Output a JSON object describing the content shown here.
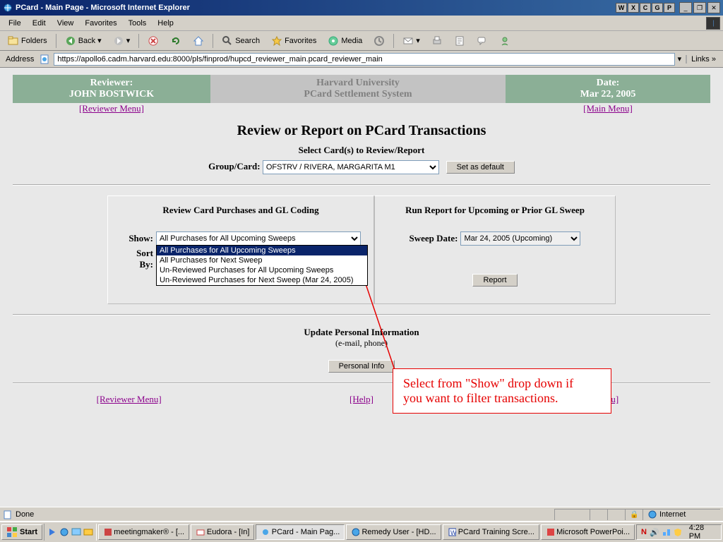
{
  "window": {
    "title": "PCard - Main Page - Microsoft Internet Explorer",
    "minimize": "_",
    "restore": "❐",
    "close": "✕"
  },
  "tray_icons": [
    "W",
    "X",
    "C",
    "G",
    "P"
  ],
  "menubar": {
    "items": [
      "File",
      "Edit",
      "View",
      "Favorites",
      "Tools",
      "Help"
    ]
  },
  "toolbar": {
    "folders": "Folders",
    "back": "Back",
    "search": "Search",
    "favorites": "Favorites",
    "media": "Media"
  },
  "addressbar": {
    "label": "Address",
    "url": "https://apollo6.cadm.harvard.edu:8000/pls/finprod/hupcd_reviewer_main.pcard_reviewer_main",
    "links": "Links",
    "chev": "»"
  },
  "header": {
    "reviewer_label": "Reviewer:",
    "reviewer_name": "JOHN BOSTWICK",
    "uni": "Harvard University",
    "sys": "PCard Settlement System",
    "date_label": "Date:",
    "date_value": "Mar 22, 2005"
  },
  "links": {
    "reviewer_menu": "[Reviewer Menu]",
    "main_menu": "[Main Menu]",
    "help": "[Help]"
  },
  "page": {
    "title": "Review or Report on PCard Transactions",
    "select_cards": "Select Card(s) to Review/Report",
    "group_card_label": "Group/Card:",
    "group_card_value": "OFSTRV / RIVERA, MARGARITA M1",
    "set_default": "Set as default"
  },
  "left_panel": {
    "title": "Review Card Purchases and GL Coding",
    "show_label": "Show:",
    "sort_label": "Sort By:",
    "show_value": "All Purchases for All Upcoming Sweeps",
    "options": [
      "All Purchases for All Upcoming Sweeps",
      "All Purchases for Next Sweep",
      "Un-Reviewed Purchases for All Upcoming Sweeps",
      "Un-Reviewed Purchases for Next Sweep (Mar 24, 2005)"
    ]
  },
  "right_panel": {
    "title": "Run Report for Upcoming or Prior GL Sweep",
    "sweep_label": "Sweep Date:",
    "sweep_value": "Mar 24, 2005 (Upcoming)",
    "report": "Report"
  },
  "annotation": {
    "text1": "Select from \"Show\" drop down if",
    "text2": "you want to filter transactions."
  },
  "personal": {
    "title": "Update Personal Information",
    "sub": "(e-mail, phone)",
    "btn": "Personal Info"
  },
  "statusbar": {
    "done": "Done",
    "zone": "Internet"
  },
  "taskbar": {
    "start": "Start",
    "items": [
      "meetingmaker® - [...",
      "Eudora - [In]",
      "PCard - Main Pag...",
      "Remedy User - [HD...",
      "PCard Training Scre...",
      "Microsoft PowerPoi..."
    ],
    "time": "4:28 PM"
  }
}
